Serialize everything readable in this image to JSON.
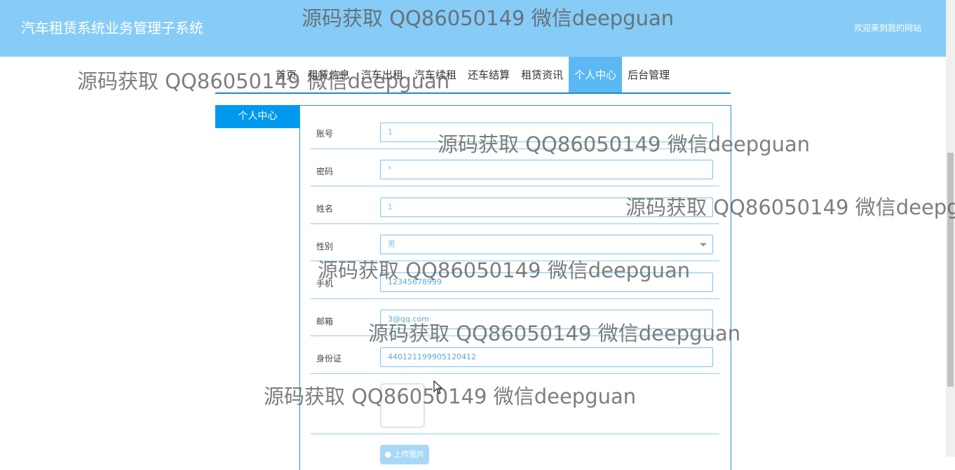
{
  "header": {
    "site_title": "汽车租赁系统业务管理子系统",
    "welcome": "欢迎来到我的网站"
  },
  "nav": {
    "items": [
      {
        "label": "首页"
      },
      {
        "label": "租赁信息"
      },
      {
        "label": "汽车出租"
      },
      {
        "label": "汽车续租"
      },
      {
        "label": "还车结算"
      },
      {
        "label": "租赁资讯"
      },
      {
        "label": "个人中心",
        "active": true
      },
      {
        "label": "后台管理"
      }
    ]
  },
  "sidebar": {
    "tab_label": "个人中心"
  },
  "form": {
    "fields": [
      {
        "label": "账号",
        "value": "1"
      },
      {
        "label": "密码",
        "value": "*"
      },
      {
        "label": "姓名",
        "value": "1"
      },
      {
        "label": "性别",
        "value": "男"
      },
      {
        "label": "手机",
        "value": "12345678999"
      },
      {
        "label": "邮箱",
        "value": "3@qq.com"
      },
      {
        "label": "身份证",
        "value": "440121199905120412"
      }
    ],
    "upload_button": "上传图片"
  },
  "watermark": "源码获取 QQ86050149 微信deepguan",
  "colors": {
    "header_bg": "#87ccf7",
    "accent": "#0099ee",
    "active_nav": "#5bb8f4"
  }
}
